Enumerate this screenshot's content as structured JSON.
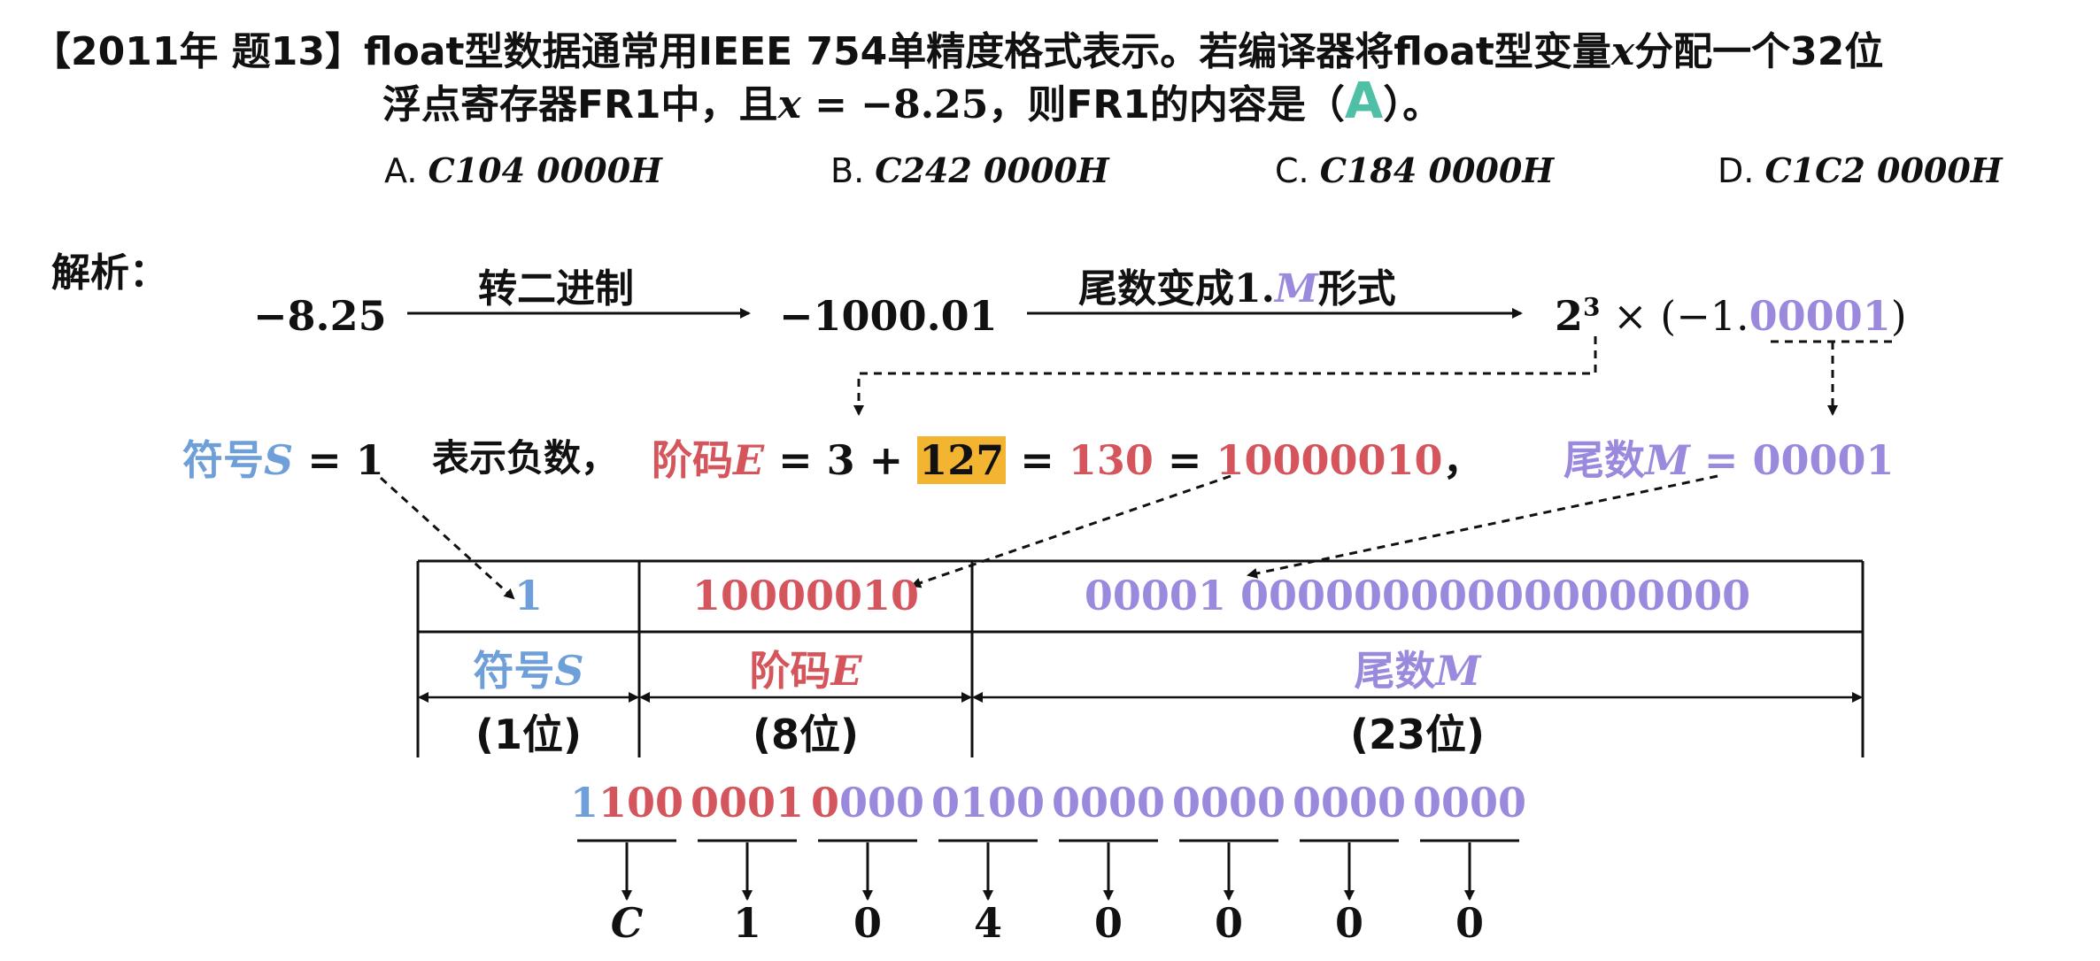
{
  "question": {
    "tag": "【2011年 题13】",
    "line1": "float型数据通常用IEEE 754单精度格式表示。若编译器将float型变量",
    "var_x": "x",
    "line1_end": "分配一个32位",
    "line2_a": "浮点寄存器FR1中，且",
    "line2_eq": " = −8.25",
    "line2_b": "，则FR1的内容是（",
    "answer": "A",
    "line2_c": "）。",
    "options": [
      {
        "letter": "A.",
        "value": "C104 0000H"
      },
      {
        "letter": "B.",
        "value": "C242 0000H"
      },
      {
        "letter": "C.",
        "value": "C184 0000H"
      },
      {
        "letter": "D.",
        "value": "C1C2 0000H"
      }
    ]
  },
  "analysis": {
    "label": "解析：",
    "step1_value": "−8.25",
    "arrow1_label": "转二进制",
    "step2_value": "−1000.01",
    "arrow2_label_a": "尾数变成",
    "arrow2_label_b": "1.",
    "arrow2_label_m": "M",
    "arrow2_label_c": "形式",
    "step3_base": "2",
    "step3_exp": "3",
    "step3_rest": " × (−1.",
    "step3_mant": "00001",
    "step3_close": ")"
  },
  "fields": {
    "sign_label": "符号",
    "sign_var": "S",
    "sign_eq": " =  1",
    "sign_desc": "表示负数，",
    "exp_label": "阶码",
    "exp_var": "E",
    "exp_eq1": " =  3 + ",
    "exp_bias": "127",
    "exp_eq2": " = ",
    "exp_dec": "130",
    "exp_eq3": " = ",
    "exp_bin": "10000010",
    "exp_comma": "，",
    "mant_label": "尾数",
    "mant_var": "M",
    "mant_eq": " = 00001"
  },
  "table": {
    "sign_bits": "1",
    "exp_bits": "10000010",
    "mant_bits": "00001 000000000000000000",
    "sign_name": "符号",
    "sign_sym": "S",
    "exp_name": "阶码",
    "exp_sym": "E",
    "mant_name": "尾数",
    "mant_sym": "M",
    "sign_width": "(1位)",
    "exp_width": "(8位)",
    "mant_width": "(23位)"
  },
  "binary_groups": [
    {
      "blue": "1",
      "red": "100",
      "purple": ""
    },
    {
      "blue": "",
      "red": "0001",
      "purple": ""
    },
    {
      "blue": "",
      "red": "0",
      "purple": "000"
    },
    {
      "blue": "",
      "red": "",
      "purple": "0100"
    },
    {
      "blue": "",
      "red": "",
      "purple": "0000"
    },
    {
      "blue": "",
      "red": "",
      "purple": "0000"
    },
    {
      "blue": "",
      "red": "",
      "purple": "0000"
    },
    {
      "blue": "",
      "red": "",
      "purple": "0000"
    }
  ],
  "hex_digits": [
    "C",
    "1",
    "0",
    "4",
    "0",
    "0",
    "0",
    "0"
  ],
  "colors": {
    "sign": "#6f9fd8",
    "exponent": "#d4555c",
    "mantissa": "#9b89dd",
    "answer": "#4fc0a6",
    "highlight": "#f3b531"
  }
}
